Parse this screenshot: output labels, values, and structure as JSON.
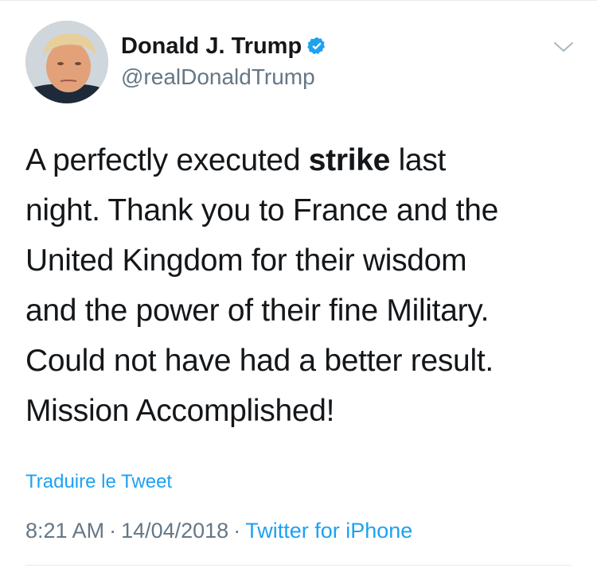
{
  "author": {
    "display_name": "Donald J. Trump",
    "handle": "@realDonaldTrump",
    "verified": true,
    "avatar_icon": "profile-photo",
    "verified_icon": "verified-badge-icon"
  },
  "tweet": {
    "lines": [
      {
        "pre": "A perfectly executed ",
        "bold": "strike",
        "post": " last"
      },
      {
        "text": "night. Thank you to France and the"
      },
      {
        "text": "United Kingdom for their wisdom"
      },
      {
        "text": "and the power of their fine Military."
      },
      {
        "text": "Could not have had a better result."
      },
      {
        "text": "Mission Accomplished!"
      }
    ],
    "translate_label": "Traduire le Tweet",
    "time": "8:21 AM",
    "date": "14/04/2018",
    "separator": "·",
    "source": "Twitter for iPhone"
  },
  "menu": {
    "icon": "chevron-down-icon"
  },
  "colors": {
    "link": "#1da1f2",
    "secondary_text": "#657786",
    "primary_text": "#14171a",
    "divider": "#e6ecf0",
    "verified": "#1da1f2"
  }
}
